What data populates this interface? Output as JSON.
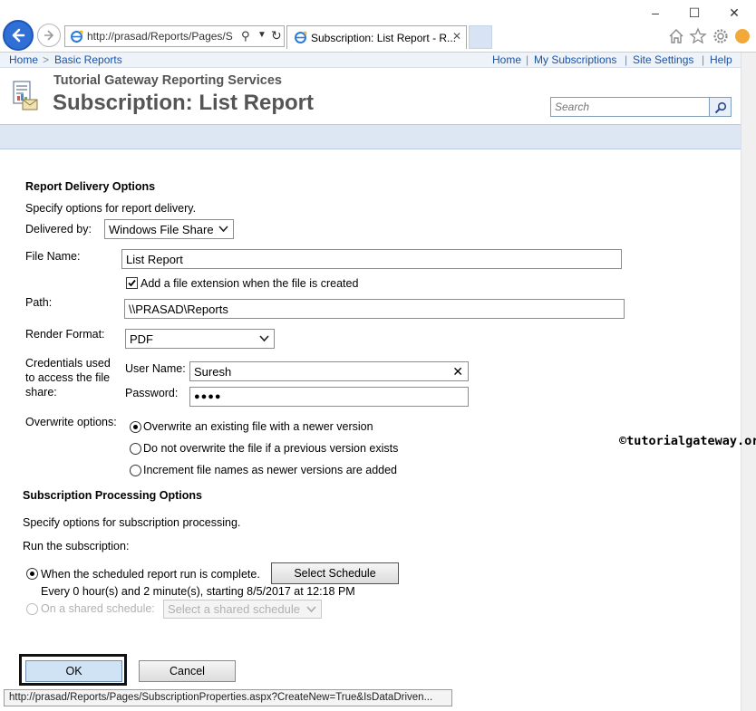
{
  "browser": {
    "address_url": "http://prasad/Reports/Pages/S",
    "tab_title": "Subscription: List Report - R...",
    "window_minimize": "–",
    "window_maximize": "☐",
    "window_close": "✕"
  },
  "nav": {
    "breadcrumb": [
      {
        "label": "Home"
      },
      {
        "label": "Basic Reports"
      }
    ],
    "breadcrumb_separator": ">",
    "links": [
      {
        "label": "Home"
      },
      {
        "label": "My Subscriptions"
      },
      {
        "label": "Site Settings"
      },
      {
        "label": "Help"
      }
    ],
    "link_separator": "|"
  },
  "header": {
    "site_name": "Tutorial Gateway Reporting Services",
    "title": "Subscription: List Report",
    "search_placeholder": "Search"
  },
  "delivery": {
    "section_title": "Report Delivery Options",
    "instructions": "Specify options for report delivery.",
    "delivered_by_label": "Delivered by:",
    "delivered_by_value": "Windows File Share",
    "file_name_label": "File Name:",
    "file_name_value": "List Report",
    "add_extension_label": "Add a file extension when the file is created",
    "add_extension_checked": true,
    "path_label": "Path:",
    "path_value": "\\\\PRASAD\\Reports",
    "render_format_label": "Render Format:",
    "render_format_value": "PDF",
    "credentials_label": "Credentials used to access the file share:",
    "username_label": "User Name:",
    "username_value": "Suresh",
    "password_label": "Password:",
    "password_value": "●●●●",
    "overwrite_label": "Overwrite options:",
    "overwrite_options": [
      {
        "label": "Overwrite an existing file with a newer version",
        "selected": true
      },
      {
        "label": "Do not overwrite the file if a previous version exists",
        "selected": false
      },
      {
        "label": "Increment file names as newer versions are added",
        "selected": false
      }
    ]
  },
  "processing": {
    "section_title": "Subscription Processing Options",
    "instructions": "Specify options for subscription processing.",
    "run_label": "Run the subscription:",
    "option_scheduled_label": "When the scheduled report run is complete.",
    "select_schedule_button": "Select Schedule",
    "schedule_description": "Every 0 hour(s) and 2 minute(s), starting 8/5/2017 at 12:18 PM",
    "option_shared_label": "On a shared schedule:",
    "shared_schedule_value": "Select a shared schedule"
  },
  "actions": {
    "ok_label": "OK",
    "cancel_label": "Cancel"
  },
  "status_bar": "http://prasad/Reports/Pages/SubscriptionProperties.aspx?CreateNew=True&IsDataDriven...",
  "watermark": "©tutorialgateway.org",
  "colors": {
    "link": "#1a52a6",
    "back_button": "#2f6fd6",
    "band": "#dde7f4",
    "ok_button": "#cfe3f5"
  }
}
